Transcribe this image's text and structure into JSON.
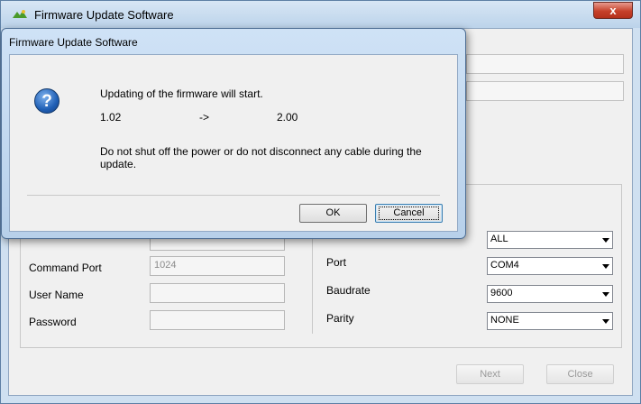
{
  "main_window": {
    "title": "Firmware Update Software",
    "close_glyph": "x"
  },
  "form": {
    "command_port": {
      "label": "Command Port",
      "value": "1024"
    },
    "user_name": {
      "label": "User Name",
      "value": ""
    },
    "password": {
      "label": "Password",
      "value": ""
    },
    "first_combo": {
      "value": "ALL"
    },
    "port": {
      "label": "Port",
      "value": "COM4"
    },
    "baudrate": {
      "label": "Baudrate",
      "value": "9600"
    },
    "parity": {
      "label": "Parity",
      "value": "NONE"
    }
  },
  "buttons": {
    "next": "Next",
    "close": "Close"
  },
  "dialog": {
    "title": "Firmware Update Software",
    "message": "Updating of the firmware will start.",
    "version_from": "1.02",
    "arrow": "->",
    "version_to": "2.00",
    "warning_line1": "Do not shut off the power or do not disconnect any cable during the",
    "warning_line2": "update.",
    "ok_label": "OK",
    "cancel_label": "Cancel",
    "icon": "question-icon"
  },
  "colors": {
    "title_bar": "#cfe0f1",
    "close_button": "#c6412a",
    "question_icon": "#1f5fb5"
  }
}
